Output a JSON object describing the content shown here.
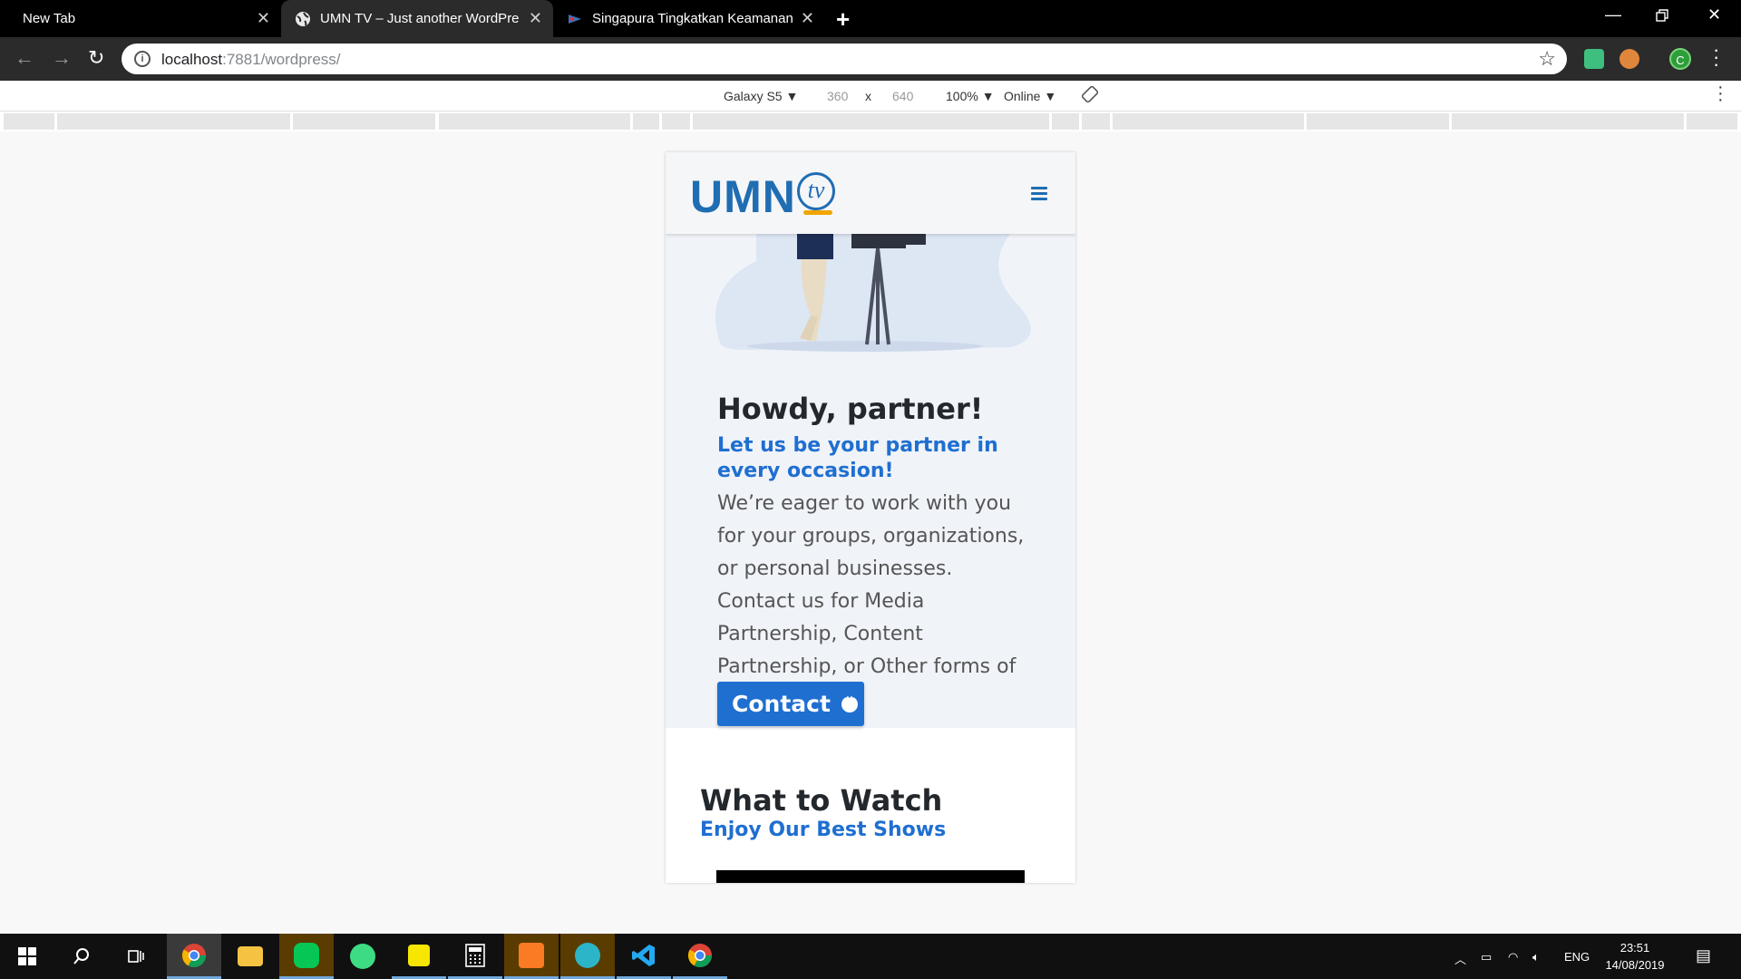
{
  "browser": {
    "tabs": [
      {
        "title": "New Tab",
        "active": false
      },
      {
        "title": "UMN TV – Just another WordPre",
        "active": true
      },
      {
        "title": "Singapura Tingkatkan Keamanan",
        "active": false
      }
    ],
    "url_host": "localhost",
    "url_path": ":7881/wordpress/",
    "profile_initial": "C"
  },
  "devtools": {
    "device": "Galaxy S5 ▼",
    "width": "360",
    "times": "x",
    "height": "640",
    "zoom": "100% ▼",
    "network": "Online ▼"
  },
  "site": {
    "logo_text": "UMN",
    "logo_badge": "tv",
    "hero": {
      "title": "Howdy, partner!",
      "subtitle": "Let us be your partner in every occasion!",
      "body": "We’re eager to work with you for your groups, organizations, or personal businesses. Contact us for Media Partnership, Content Partnership, or Other forms of Partnership.",
      "cta": "Contact"
    },
    "watch": {
      "title": "What to Watch",
      "subtitle": "Enjoy Our Best Shows"
    }
  },
  "taskbar": {
    "language": "ENG",
    "time": "23:51",
    "date": "14/08/2019"
  },
  "colors": {
    "brand_blue": "#1f6fd1",
    "logo_blue": "#1f6db2",
    "heading": "#23282d"
  }
}
